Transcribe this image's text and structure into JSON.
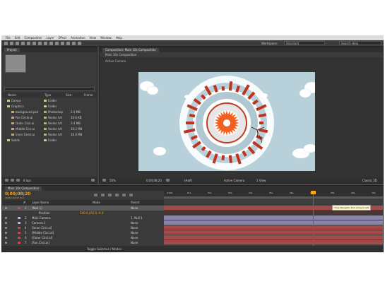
{
  "menu": [
    "File",
    "Edit",
    "Composition",
    "Layer",
    "Effect",
    "Animation",
    "View",
    "Window",
    "Help"
  ],
  "toolbar": {
    "workspace_label": "Workspace:",
    "workspace_value": "Standard",
    "search_placeholder": "Search Help"
  },
  "project": {
    "tab": "Project",
    "search_value": "",
    "columns": [
      "Name",
      "Type",
      "Size",
      "Frame"
    ],
    "items": [
      {
        "name": "Comps",
        "type": "Folder",
        "size": "",
        "color": "#d9c66a",
        "indent": 0
      },
      {
        "name": "Graphics",
        "type": "Folder",
        "size": "",
        "color": "#d9c66a",
        "indent": 0
      },
      {
        "name": "background.psd",
        "type": "Photoshop",
        "size": "2.0 MB",
        "color": "#c7a56b",
        "indent": 1
      },
      {
        "name": "Fan Circle.ai",
        "type": "Vector Art",
        "size": "10.6 KB",
        "color": "#c7a56b",
        "indent": 1
      },
      {
        "name": "Outer Circl.ai",
        "type": "Vector Art",
        "size": "3.4 MB",
        "color": "#c7a56b",
        "indent": 1
      },
      {
        "name": "Middle Circ.ai",
        "type": "Vector Art",
        "size": "10.2 MB",
        "color": "#c7a56b",
        "indent": 1
      },
      {
        "name": "Inner Centr.ai",
        "type": "Vector Art",
        "size": "10.0 MB",
        "color": "#c7a56b",
        "indent": 1
      },
      {
        "name": "Solids",
        "type": "Folder",
        "size": "",
        "color": "#d9c66a",
        "indent": 0
      }
    ],
    "footer_bpc": "8 bpc"
  },
  "viewer": {
    "tab": "Composition: Main 10s Composition",
    "sub_tab": "Main 10s Composition",
    "camera": "Active Camera",
    "view_label": "1 View",
    "zoom": "50%",
    "timecode": "0;00;08;20",
    "resolution": "(Half)",
    "renderer_label": "Classic 3D"
  },
  "timeline": {
    "tab": "Main 10s Composition",
    "timecode": "0;00;08;20",
    "fps_note": "00260 (29.97 fps)",
    "columns": [
      "#",
      "Layer Name",
      "Mode",
      "Parent"
    ],
    "ruler": [
      "0;00s",
      "01s",
      "02s",
      "03s",
      "04s",
      "05s",
      "06s",
      "07s",
      "08s",
      "09s",
      "10s"
    ],
    "layers": [
      {
        "num": "1",
        "name": "[Null 1]",
        "label": "#c74b4b",
        "parent": "None",
        "sel": true
      },
      {
        "num": "",
        "name": "Position",
        "label": "",
        "parent": "",
        "sel": false,
        "sub": true,
        "value": "540.0,432.0,-0.0"
      },
      {
        "num": "2",
        "name": "Main Camera",
        "label": "#b8b0d8",
        "parent": "1. Null 1",
        "sel": false
      },
      {
        "num": "3",
        "name": "Camera 1",
        "label": "#b8b0d8",
        "parent": "None",
        "sel": false
      },
      {
        "num": "4",
        "name": "[Inner Circl.ai]",
        "label": "#c74b4b",
        "parent": "None",
        "sel": false
      },
      {
        "num": "5",
        "name": "[Middle Circl.ai]",
        "label": "#c74b4b",
        "parent": "None",
        "sel": false
      },
      {
        "num": "6",
        "name": "[Outer Circl.ai]",
        "label": "#c74b4b",
        "parent": "None",
        "sel": false
      },
      {
        "num": "7",
        "name": "[Fan Circl.ai]",
        "label": "#c74b4b",
        "parent": "None",
        "sel": false
      }
    ],
    "footer": "Toggle Switches / Modes",
    "tooltip": "Time Navigator End (drag to set)"
  },
  "colors": {
    "accent": "#f2a427",
    "playhead": "#d83a2a",
    "layer_bar_red": "#a44a4a",
    "layer_bar_purple": "#8c84ad"
  }
}
